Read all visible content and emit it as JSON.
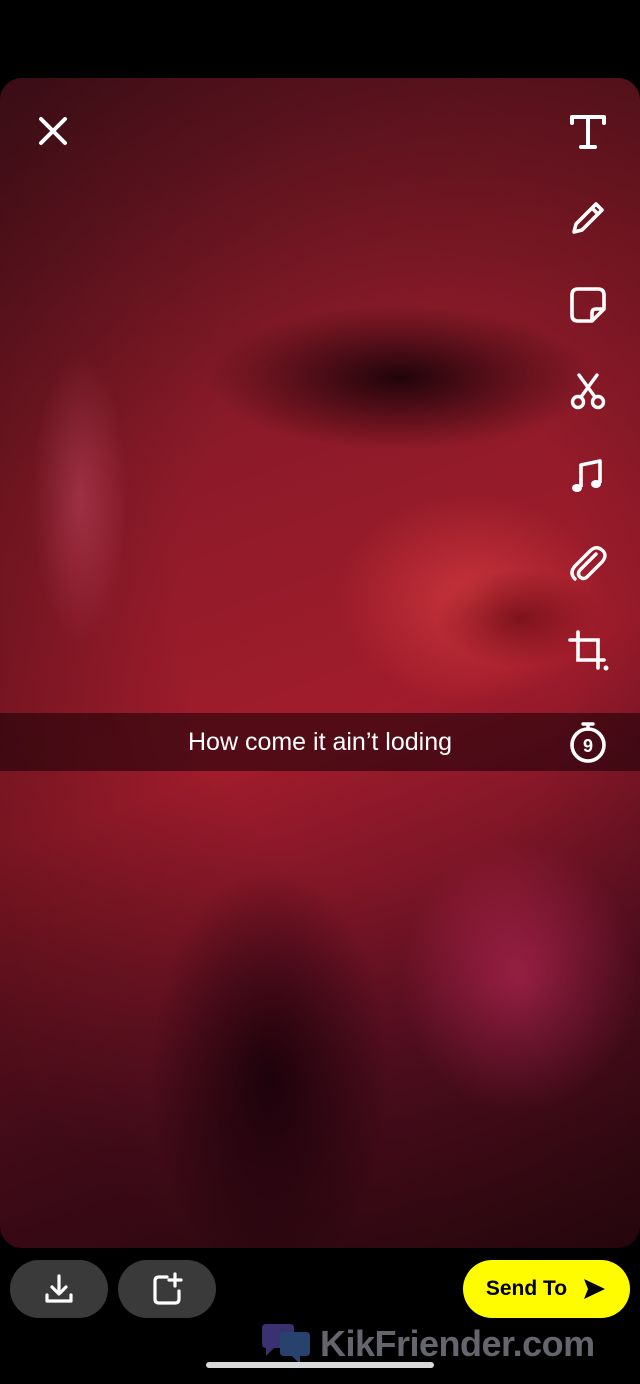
{
  "caption": {
    "text": "How come it ain’t loding"
  },
  "timer": {
    "value": "9"
  },
  "toolbar": {
    "items": [
      {
        "name": "text"
      },
      {
        "name": "draw"
      },
      {
        "name": "sticker"
      },
      {
        "name": "scissors"
      },
      {
        "name": "music"
      },
      {
        "name": "attachment"
      },
      {
        "name": "crop"
      },
      {
        "name": "timer"
      }
    ]
  },
  "bottom": {
    "send_label": "Send To"
  },
  "watermark": {
    "text": "KikFriender.com"
  },
  "colors": {
    "send_button": "#fffc00",
    "bottom_button_bg": "#3a3a3a",
    "icon": "#ffffff"
  }
}
